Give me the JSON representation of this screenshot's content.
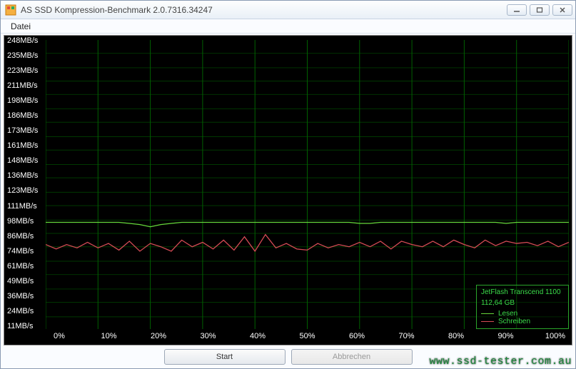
{
  "window": {
    "title": "AS SSD Kompression-Benchmark 2.0.7316.34247",
    "min_title": "–",
    "max_title": "▢",
    "close_title": "✕"
  },
  "menu": {
    "file": "Datei"
  },
  "chart_data": {
    "type": "line",
    "title": "",
    "xlabel": "",
    "ylabel": "",
    "y_unit": "MB/s",
    "ylim": [
      0,
      260
    ],
    "xlim": [
      0,
      100
    ],
    "x_ticks": [
      "0%",
      "10%",
      "20%",
      "30%",
      "40%",
      "50%",
      "60%",
      "70%",
      "80%",
      "90%",
      "100%"
    ],
    "y_ticks": [
      11,
      24,
      36,
      49,
      61,
      74,
      86,
      98,
      111,
      123,
      136,
      148,
      161,
      173,
      186,
      198,
      211,
      223,
      235,
      248
    ],
    "y_tick_labels": [
      "11MB/s",
      "24MB/s",
      "36MB/s",
      "49MB/s",
      "61MB/s",
      "74MB/s",
      "86MB/s",
      "98MB/s",
      "111MB/s",
      "123MB/s",
      "136MB/s",
      "148MB/s",
      "161MB/s",
      "173MB/s",
      "186MB/s",
      "198MB/s",
      "211MB/s",
      "223MB/s",
      "235MB/s",
      "248MB/s"
    ],
    "series": [
      {
        "name": "Lesen",
        "color": "#65d83a",
        "x": [
          0,
          2,
          4,
          6,
          8,
          10,
          12,
          14,
          16,
          18,
          20,
          22,
          24,
          26,
          28,
          30,
          32,
          34,
          36,
          38,
          40,
          42,
          44,
          46,
          48,
          50,
          52,
          54,
          56,
          58,
          60,
          62,
          64,
          66,
          68,
          70,
          72,
          74,
          76,
          78,
          80,
          82,
          84,
          86,
          88,
          90,
          92,
          94,
          96,
          98,
          100
        ],
        "values": [
          96,
          96,
          96,
          96,
          96,
          96,
          96,
          96,
          95,
          94,
          92,
          94,
          95,
          96,
          96,
          96,
          96,
          96,
          96,
          96,
          96,
          96,
          96,
          96,
          96,
          96,
          96,
          96,
          96,
          96,
          95,
          95,
          96,
          96,
          96,
          96,
          96,
          96,
          96,
          96,
          96,
          96,
          96,
          96,
          95,
          96,
          96,
          96,
          96,
          96,
          96
        ]
      },
      {
        "name": "Schreiben",
        "color": "#d64b55",
        "x": [
          0,
          2,
          4,
          6,
          8,
          10,
          12,
          14,
          16,
          18,
          20,
          22,
          24,
          26,
          28,
          30,
          32,
          34,
          36,
          38,
          40,
          42,
          44,
          46,
          48,
          50,
          52,
          54,
          56,
          58,
          60,
          62,
          64,
          66,
          68,
          70,
          72,
          74,
          76,
          78,
          80,
          82,
          84,
          86,
          88,
          90,
          92,
          94,
          96,
          98,
          100
        ],
        "values": [
          76,
          72,
          76,
          73,
          78,
          73,
          77,
          71,
          79,
          70,
          77,
          74,
          70,
          80,
          74,
          78,
          72,
          80,
          71,
          83,
          70,
          85,
          73,
          77,
          72,
          71,
          77,
          73,
          76,
          74,
          78,
          74,
          79,
          72,
          79,
          76,
          74,
          79,
          74,
          80,
          76,
          73,
          80,
          75,
          79,
          77,
          78,
          75,
          79,
          74,
          78
        ]
      }
    ]
  },
  "legend": {
    "device": "JetFlash Transcend 1100",
    "capacity": "112,64 GB",
    "read_label": "Lesen",
    "write_label": "Schreiben"
  },
  "buttons": {
    "start": "Start",
    "abort": "Abbrechen"
  },
  "watermark": "www.ssd-tester.com.au"
}
